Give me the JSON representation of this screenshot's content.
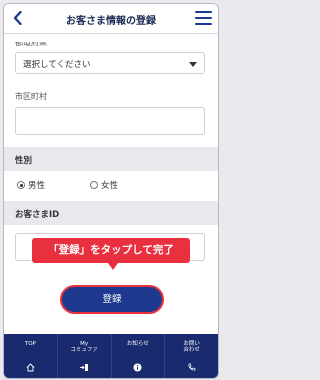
{
  "header": {
    "back_icon": "chevron-left-icon",
    "title": "お客さま情報の登録",
    "menu_icon": "hamburger-icon"
  },
  "form": {
    "select_value": "選択してください",
    "city_label": "市区町村",
    "city_value": "",
    "gender_section": "性別",
    "gender_options": [
      {
        "label": "男性",
        "checked": true
      },
      {
        "label": "女性",
        "checked": false
      }
    ],
    "id_section": "お客さまID",
    "id_value": ""
  },
  "tooltip": "「登録」をタップして完了",
  "register_button": "登録",
  "tabs": [
    {
      "label": "TOP",
      "icon": "home-icon"
    },
    {
      "label": "My\nコミュファ",
      "icon": "login-icon"
    },
    {
      "label": "お知らせ",
      "icon": "info-icon"
    },
    {
      "label": "お問い\n合わせ",
      "icon": "phone-icon"
    }
  ],
  "colors": {
    "brand": "#1d3a8f",
    "accent": "#e8303f",
    "tabbar": "#1a2a6e"
  }
}
